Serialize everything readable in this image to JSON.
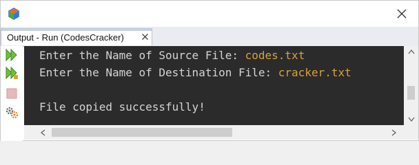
{
  "window": {
    "app_icon": "netbeans-cube-icon",
    "close_icon": "close-icon"
  },
  "tab": {
    "label": "Output - Run (CodesCracker)",
    "close_icon": "tab-close-icon"
  },
  "toolbar": {
    "icons": [
      "rerun-icon",
      "rerun-with-args-icon",
      "stop-icon",
      "settings-icon"
    ]
  },
  "output": {
    "lines": [
      {
        "prompt": "Enter the Name of Source File: ",
        "input": "codes.txt"
      },
      {
        "prompt": "Enter the Name of Destination File: ",
        "input": "cracker.txt"
      },
      {
        "prompt": "",
        "input": ""
      },
      {
        "prompt": "File copied successfully!",
        "input": ""
      }
    ]
  },
  "colors": {
    "console_bg": "#2b2b2b",
    "console_text": "#d4d4d4",
    "user_input": "#d7a23a",
    "run_green": "#5aa52b"
  }
}
